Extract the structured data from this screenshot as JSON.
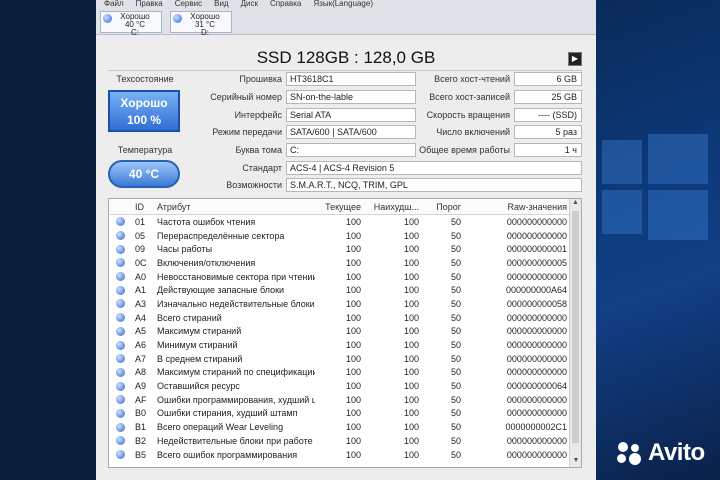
{
  "menu": [
    "Файл",
    "Правка",
    "Сервис",
    "Вид",
    "Диск",
    "Справка",
    "Язык(Language)"
  ],
  "drives": [
    {
      "status": "Хорошо",
      "temp": "40 °C",
      "letter": "C:"
    },
    {
      "status": "Хорошо",
      "temp": "31 °C",
      "letter": "D:"
    }
  ],
  "title": "SSD 128GB : 128,0 GB",
  "health": {
    "label": "Техсостояние",
    "status": "Хорошо",
    "percent": "100 %"
  },
  "temperature": {
    "label": "Температура",
    "value": "40 °C"
  },
  "info": {
    "firmware": {
      "label": "Прошивка",
      "value": "HT3618C1"
    },
    "serial": {
      "label": "Серийный номер",
      "value": "SN-on-the-lable"
    },
    "interface": {
      "label": "Интерфейс",
      "value": "Serial ATA"
    },
    "transfer": {
      "label": "Режим передачи",
      "value": "SATA/600 | SATA/600"
    },
    "volume": {
      "label": "Буква тома",
      "value": "C:"
    },
    "standard": {
      "label": "Стандарт",
      "value": "ACS-4 | ACS-4 Revision 5"
    },
    "features": {
      "label": "Возможности",
      "value": "S.M.A.R.T., NCQ, TRIM, GPL"
    },
    "host_reads": {
      "label": "Всего хост-чтений",
      "value": "6 GB"
    },
    "host_writes": {
      "label": "Всего хост-записей",
      "value": "25 GB"
    },
    "rotation": {
      "label": "Скорость вращения",
      "value": "---- (SSD)"
    },
    "power_count": {
      "label": "Число включений",
      "value": "5 раз"
    },
    "power_hours": {
      "label": "Общее время работы",
      "value": "1 ч"
    }
  },
  "table": {
    "headers": [
      "ID",
      "Атрибут",
      "Текущее",
      "Наихудш...",
      "Порог",
      "Raw-значения"
    ],
    "rows": [
      [
        "01",
        "Частота ошибок чтения",
        "100",
        "100",
        "50",
        "000000000000"
      ],
      [
        "05",
        "Перераспределённые сектора",
        "100",
        "100",
        "50",
        "000000000000"
      ],
      [
        "09",
        "Часы работы",
        "100",
        "100",
        "50",
        "000000000001"
      ],
      [
        "0C",
        "Включения/отключения",
        "100",
        "100",
        "50",
        "000000000005"
      ],
      [
        "A0",
        "Невосстановимые сектора при чтении/за...",
        "100",
        "100",
        "50",
        "000000000000"
      ],
      [
        "A1",
        "Действующие запасные блоки",
        "100",
        "100",
        "50",
        "000000000A64"
      ],
      [
        "A3",
        "Изначально недействительные блоки",
        "100",
        "100",
        "50",
        "000000000058"
      ],
      [
        "A4",
        "Всего стираний",
        "100",
        "100",
        "50",
        "000000000000"
      ],
      [
        "A5",
        "Максимум стираний",
        "100",
        "100",
        "50",
        "000000000000"
      ],
      [
        "A6",
        "Минимум стираний",
        "100",
        "100",
        "50",
        "000000000000"
      ],
      [
        "A7",
        "В среднем стираний",
        "100",
        "100",
        "50",
        "000000000000"
      ],
      [
        "A8",
        "Максимум стираний по спецификации",
        "100",
        "100",
        "50",
        "000000000000"
      ],
      [
        "A9",
        "Оставшийся ресурс",
        "100",
        "100",
        "50",
        "000000000064"
      ],
      [
        "AF",
        "Ошибки программирования, худший шта...",
        "100",
        "100",
        "50",
        "000000000000"
      ],
      [
        "B0",
        "Ошибки стирания, худший штамп",
        "100",
        "100",
        "50",
        "000000000000"
      ],
      [
        "B1",
        "Всего операций Wear Leveling",
        "100",
        "100",
        "50",
        "0000000002C1"
      ],
      [
        "B2",
        "Недействительные блоки при работе",
        "100",
        "100",
        "50",
        "000000000000"
      ],
      [
        "B5",
        "Всего ошибок программирования",
        "100",
        "100",
        "50",
        "000000000000"
      ]
    ]
  },
  "watermark": "Avito"
}
